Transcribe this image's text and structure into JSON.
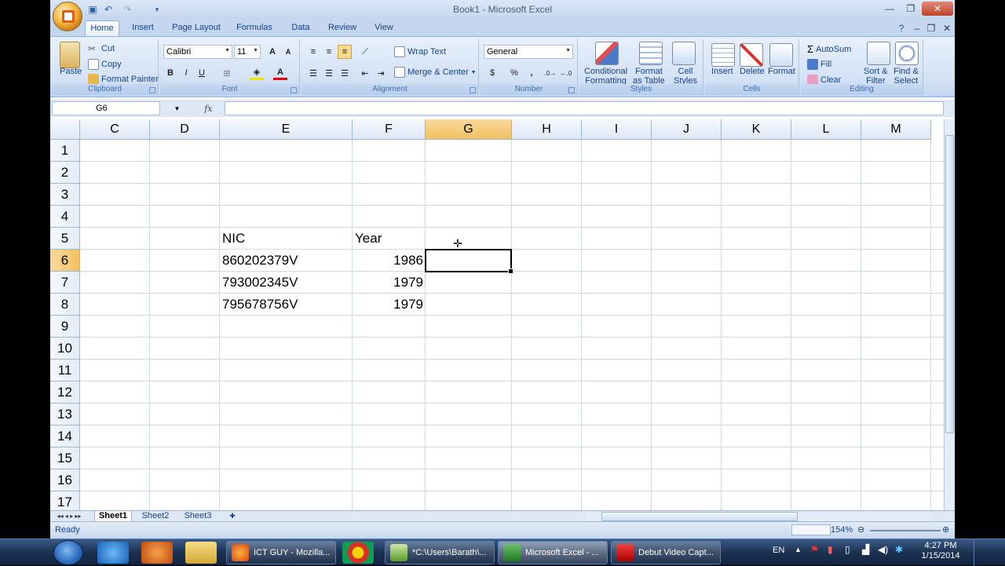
{
  "window": {
    "title": "Book1 - Microsoft Excel"
  },
  "tabs": [
    {
      "label": "Home"
    },
    {
      "label": "Insert"
    },
    {
      "label": "Page Layout"
    },
    {
      "label": "Formulas"
    },
    {
      "label": "Data"
    },
    {
      "label": "Review"
    },
    {
      "label": "View"
    }
  ],
  "ribbon": {
    "clipboard": {
      "label": "Clipboard",
      "paste": "Paste",
      "cut": "Cut",
      "copy": "Copy",
      "format_painter": "Format Painter"
    },
    "font": {
      "label": "Font",
      "name": "Calibri",
      "size": "11"
    },
    "alignment": {
      "label": "Alignment",
      "wrap_text": "Wrap Text",
      "merge_center": "Merge & Center"
    },
    "number": {
      "label": "Number",
      "format": "General",
      "currency": "$",
      "percent": "%",
      "comma": ","
    },
    "styles": {
      "label": "Styles",
      "conditional": "Conditional",
      "conditional2": "Formatting",
      "format_table": "Format",
      "format_table2": "as Table",
      "cell_styles": "Cell",
      "cell_styles2": "Styles"
    },
    "cells": {
      "label": "Cells",
      "insert": "Insert",
      "delete": "Delete",
      "format": "Format"
    },
    "editing": {
      "label": "Editing",
      "autosum": "AutoSum",
      "fill": "Fill",
      "clear": "Clear",
      "sort": "Sort &",
      "sort2": "Filter",
      "find": "Find &",
      "find2": "Select"
    }
  },
  "formula_bar": {
    "name_box": "G6",
    "fx": "fx",
    "value": ""
  },
  "columns": [
    "C",
    "D",
    "E",
    "F",
    "G",
    "H",
    "I",
    "J",
    "K",
    "L",
    "M"
  ],
  "rows": [
    "1",
    "2",
    "3",
    "4",
    "5",
    "6",
    "7",
    "8",
    "9",
    "10",
    "11",
    "12",
    "13",
    "14",
    "15",
    "16",
    "17"
  ],
  "cells": {
    "E5": "NIC",
    "F5": "Year",
    "E6": "860202379V",
    "F6": "1986",
    "E7": "793002345V",
    "F7": "1979",
    "E8": "795678756V",
    "F8": "1979"
  },
  "selected_cell": "G6",
  "sheets": [
    "Sheet1",
    "Sheet2",
    "Sheet3"
  ],
  "active_sheet": "Sheet1",
  "status": {
    "text": "Ready",
    "zoom": "154%"
  },
  "taskbar": {
    "tasks": [
      {
        "label": "ICT GUY - Mozilla..."
      },
      {
        "label": "*C:\\Users\\Barath\\..."
      },
      {
        "label": "Microsoft Excel - ..."
      },
      {
        "label": "Debut Video Capt..."
      }
    ],
    "lang": "EN",
    "time": "4:27 PM",
    "date": "1/15/2014"
  }
}
